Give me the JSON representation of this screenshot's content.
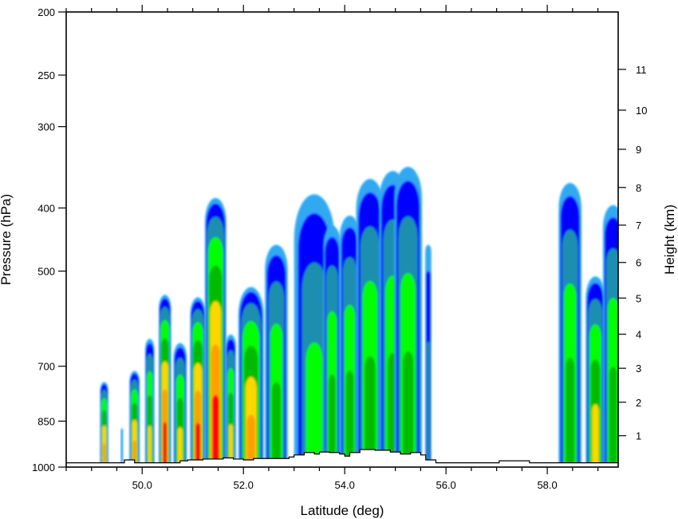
{
  "chart_data": {
    "type": "heatmap",
    "title": "",
    "xlabel": "Latitude (deg)",
    "ylabel": "Pressure (hPa)",
    "y2label": "Height (km)",
    "xlim": [
      48.5,
      59.4
    ],
    "ylim_hpa": [
      1000,
      200
    ],
    "y_scale": "log",
    "x_ticks": [
      {
        "value": 50,
        "label": "50.0"
      },
      {
        "value": 52,
        "label": "52.0"
      },
      {
        "value": 54,
        "label": "54.0"
      },
      {
        "value": 56,
        "label": "56.0"
      },
      {
        "value": 58,
        "label": "58.0"
      }
    ],
    "y_ticks": [
      {
        "value": 200,
        "label": "200"
      },
      {
        "value": 250,
        "label": "250"
      },
      {
        "value": 300,
        "label": "300"
      },
      {
        "value": 400,
        "label": "400"
      },
      {
        "value": 500,
        "label": "500"
      },
      {
        "value": 700,
        "label": "700"
      },
      {
        "value": 850,
        "label": "850"
      },
      {
        "value": 1000,
        "label": "1000"
      }
    ],
    "y2_ticks": [
      {
        "hpa": 895,
        "label": "1"
      },
      {
        "hpa": 795,
        "label": "2"
      },
      {
        "hpa": 705,
        "label": "3"
      },
      {
        "hpa": 625,
        "label": "4"
      },
      {
        "hpa": 550,
        "label": "5"
      },
      {
        "hpa": 485,
        "label": "6"
      },
      {
        "hpa": 425,
        "label": "7"
      },
      {
        "hpa": 372,
        "label": "8"
      },
      {
        "hpa": 325,
        "label": "9"
      },
      {
        "hpa": 283,
        "label": "10"
      },
      {
        "hpa": 245,
        "label": "11"
      }
    ],
    "level_colors": [
      "#33a8f0",
      "#0000ff",
      "#1f8fb0",
      "#00ff00",
      "#00bb00",
      "#ffd700",
      "#ffa000",
      "#ff0000"
    ],
    "cells": [
      {
        "lat": 49.25,
        "w": 0.16,
        "top_hpa": 720,
        "top_level": 6
      },
      {
        "lat": 49.6,
        "w": 0.05,
        "top_hpa": 860,
        "top_level": 0
      },
      {
        "lat": 49.85,
        "w": 0.2,
        "top_hpa": 690,
        "top_level": 6
      },
      {
        "lat": 50.15,
        "w": 0.18,
        "top_hpa": 610,
        "top_level": 5
      },
      {
        "lat": 50.45,
        "w": 0.24,
        "top_hpa": 515,
        "top_level": 7
      },
      {
        "lat": 50.75,
        "w": 0.26,
        "top_hpa": 620,
        "top_level": 5
      },
      {
        "lat": 51.1,
        "w": 0.3,
        "top_hpa": 520,
        "top_level": 7
      },
      {
        "lat": 51.45,
        "w": 0.42,
        "top_hpa": 355,
        "top_level": 7
      },
      {
        "lat": 51.75,
        "w": 0.2,
        "top_hpa": 600,
        "top_level": 5
      },
      {
        "lat": 52.15,
        "w": 0.5,
        "top_hpa": 500,
        "top_level": 6
      },
      {
        "lat": 52.65,
        "w": 0.45,
        "top_hpa": 425,
        "top_level": 4
      },
      {
        "lat": 53.4,
        "w": 0.8,
        "top_hpa": 350,
        "top_level": 3
      },
      {
        "lat": 53.75,
        "w": 0.35,
        "top_hpa": 395,
        "top_level": 4
      },
      {
        "lat": 54.1,
        "w": 0.4,
        "top_hpa": 380,
        "top_level": 4
      },
      {
        "lat": 54.5,
        "w": 0.55,
        "top_hpa": 330,
        "top_level": 4
      },
      {
        "lat": 54.95,
        "w": 0.55,
        "top_hpa": 320,
        "top_level": 4
      },
      {
        "lat": 55.25,
        "w": 0.55,
        "top_hpa": 315,
        "top_level": 4
      },
      {
        "lat": 55.65,
        "w": 0.12,
        "top_hpa": 425,
        "top_level": 2
      },
      {
        "lat": 58.45,
        "w": 0.45,
        "top_hpa": 335,
        "top_level": 4
      },
      {
        "lat": 58.95,
        "w": 0.38,
        "top_hpa": 480,
        "top_level": 5
      },
      {
        "lat": 59.3,
        "w": 0.4,
        "top_hpa": 365,
        "top_level": 4
      }
    ],
    "terrain_hpa": [
      [
        48.5,
        985
      ],
      [
        49.6,
        985
      ],
      [
        49.65,
        975
      ],
      [
        49.8,
        975
      ],
      [
        49.85,
        985
      ],
      [
        50.7,
        985
      ],
      [
        50.75,
        978
      ],
      [
        50.9,
        975
      ],
      [
        51.2,
        972
      ],
      [
        51.6,
        968
      ],
      [
        51.8,
        972
      ],
      [
        52.0,
        975
      ],
      [
        52.2,
        970
      ],
      [
        52.6,
        970
      ],
      [
        52.9,
        965
      ],
      [
        53.0,
        958
      ],
      [
        53.2,
        950
      ],
      [
        53.4,
        955
      ],
      [
        53.5,
        948
      ],
      [
        53.7,
        950
      ],
      [
        53.9,
        955
      ],
      [
        54.0,
        962
      ],
      [
        54.1,
        950
      ],
      [
        54.3,
        940
      ],
      [
        54.6,
        942
      ],
      [
        54.9,
        948
      ],
      [
        55.1,
        955
      ],
      [
        55.3,
        950
      ],
      [
        55.5,
        958
      ],
      [
        55.6,
        975
      ],
      [
        55.8,
        985
      ],
      [
        57.0,
        985
      ],
      [
        57.05,
        978
      ],
      [
        57.6,
        978
      ],
      [
        57.65,
        985
      ],
      [
        59.4,
        985
      ]
    ]
  }
}
